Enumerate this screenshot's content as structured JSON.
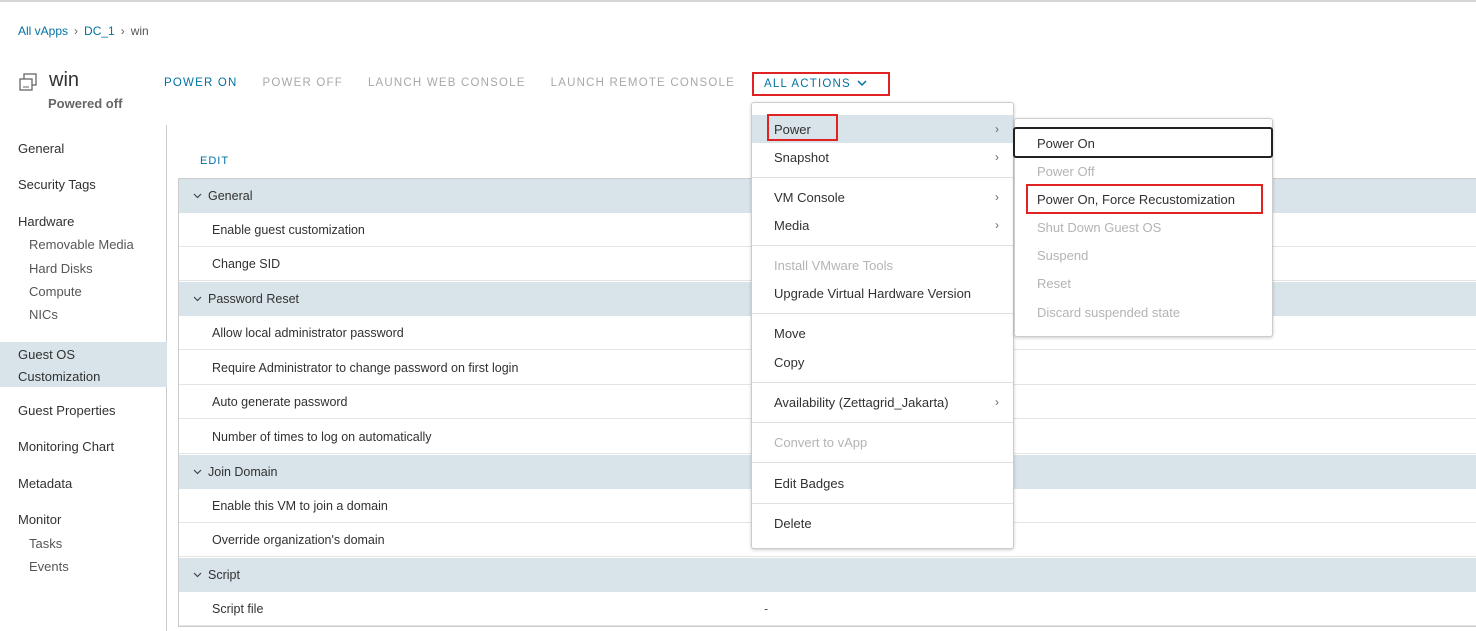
{
  "breadcrumb": {
    "items": [
      "All vApps",
      "DC_1"
    ],
    "current": "win"
  },
  "vm": {
    "name": "win",
    "status": "Powered off",
    "icon": "vm-icon"
  },
  "actions": {
    "power_on": "POWER ON",
    "power_off": "POWER OFF",
    "launch_web_console": "LAUNCH WEB CONSOLE",
    "launch_remote_console": "LAUNCH REMOTE CONSOLE",
    "all_actions": "ALL ACTIONS"
  },
  "sidebar": {
    "general": "General",
    "security_tags": "Security Tags",
    "hardware": "Hardware",
    "removable_media": "Removable Media",
    "hard_disks": "Hard Disks",
    "compute": "Compute",
    "nics": "NICs",
    "guest_os_line1": "Guest OS",
    "guest_os_line2": "Customization",
    "guest_properties": "Guest Properties",
    "monitoring_chart": "Monitoring Chart",
    "metadata": "Metadata",
    "monitor": "Monitor",
    "tasks": "Tasks",
    "events": "Events"
  },
  "main": {
    "edit_label": "EDIT",
    "sections": {
      "general": "General",
      "password_reset": "Password Reset",
      "join_domain": "Join Domain",
      "script": "Script"
    },
    "items": {
      "enable_guest_customization": "Enable guest customization",
      "change_sid": "Change SID",
      "allow_local_admin_password": "Allow local administrator password",
      "require_admin_change_password": "Require Administrator to change password on first login",
      "auto_generate_password": "Auto generate password",
      "times_to_log_on": "Number of times to log on automatically",
      "enable_join_domain": "Enable this VM to join a domain",
      "override_org_domain": "Override organization's domain",
      "script_file": "Script file"
    },
    "script_file_value": "-"
  },
  "all_actions_menu": {
    "power": "Power",
    "snapshot": "Snapshot",
    "vm_console": "VM Console",
    "media": "Media",
    "install_vmware_tools": "Install VMware Tools",
    "upgrade_hardware": "Upgrade Virtual Hardware Version",
    "move": "Move",
    "copy": "Copy",
    "availability": "Availability (Zettagrid_Jakarta)",
    "convert_to_vapp": "Convert to vApp",
    "edit_badges": "Edit Badges",
    "delete": "Delete"
  },
  "power_submenu": {
    "power_on": "Power On",
    "power_off": "Power Off",
    "power_on_force": "Power On, Force Recustomization",
    "shut_down_guest": "Shut Down Guest OS",
    "suspend": "Suspend",
    "reset": "Reset",
    "discard_suspended": "Discard suspended state"
  },
  "colors": {
    "accent": "#0072a3",
    "highlight_box": "#e12222",
    "section_bg": "#d9e4ea"
  }
}
